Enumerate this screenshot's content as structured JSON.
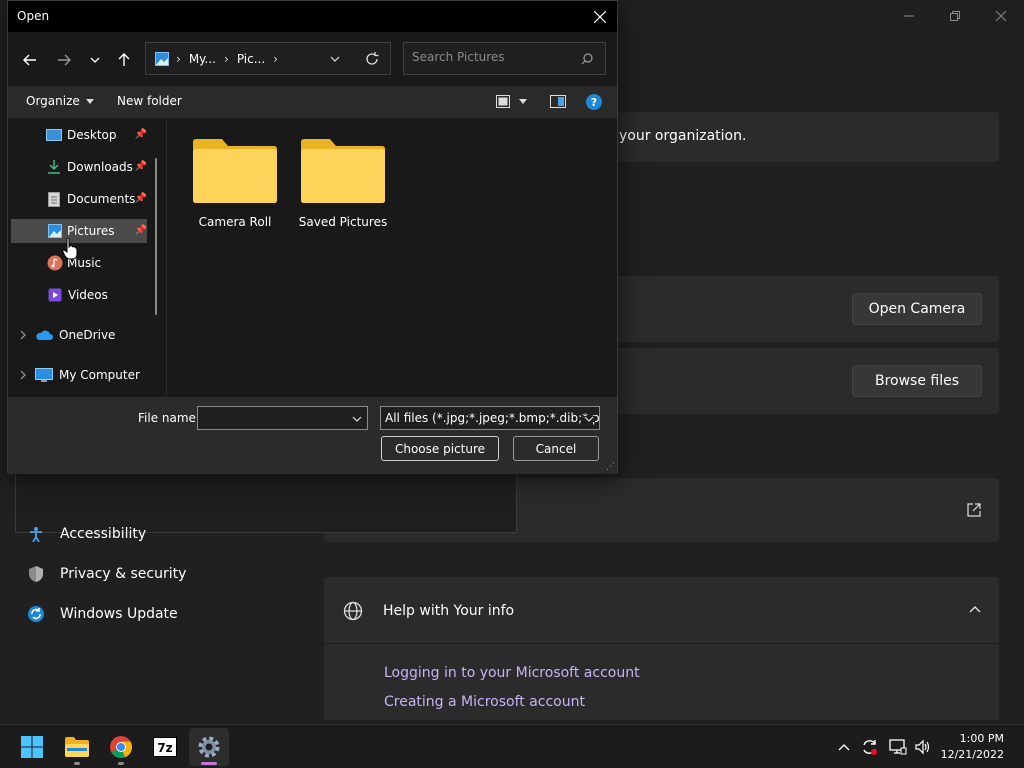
{
  "settings": {
    "org_text": "your organization.",
    "open_camera": "Open Camera",
    "browse_files": "Browse files",
    "nav": [
      {
        "label": "Accessibility",
        "icon": "accessibility-icon"
      },
      {
        "label": "Privacy & security",
        "icon": "shield-icon"
      },
      {
        "label": "Windows Update",
        "icon": "windows-update-icon"
      }
    ],
    "help": {
      "title": "Help with Your info",
      "links": [
        "Logging in to your Microsoft account",
        "Creating a Microsoft account"
      ]
    },
    "window_controls": [
      "minimize",
      "maximize",
      "close"
    ]
  },
  "dialog": {
    "title": "Open",
    "breadcrumb": [
      "My...",
      "Pic..."
    ],
    "search_placeholder": "Search Pictures",
    "organize": "Organize",
    "new_folder": "New folder",
    "tree": [
      {
        "label": "Desktop",
        "icon": "desktop-icon",
        "pinned": true
      },
      {
        "label": "Downloads",
        "icon": "download-icon",
        "pinned": true
      },
      {
        "label": "Documents",
        "icon": "documents-icon",
        "pinned": true
      },
      {
        "label": "Pictures",
        "icon": "pictures-icon",
        "pinned": true,
        "selected": true
      },
      {
        "label": "Music",
        "icon": "music-icon",
        "pinned": false
      },
      {
        "label": "Videos",
        "icon": "videos-icon",
        "pinned": false
      },
      {
        "label": "OneDrive",
        "icon": "onedrive-icon",
        "expandable": true
      },
      {
        "label": "My Computer",
        "icon": "computer-icon",
        "expandable": true
      }
    ],
    "folders": [
      "Camera Roll",
      "Saved Pictures"
    ],
    "file_name_label": "File name:",
    "file_name_value": "",
    "file_type": "All files (*.jpg;*.jpeg;*.bmp;*.dib;*.png",
    "choose": "Choose picture",
    "cancel": "Cancel"
  },
  "taskbar": {
    "apps": [
      "start-icon",
      "file-explorer-icon",
      "chrome-icon",
      "7zip-icon",
      "settings-icon"
    ],
    "time": "1:00 PM",
    "date": "12/21/2022"
  }
}
